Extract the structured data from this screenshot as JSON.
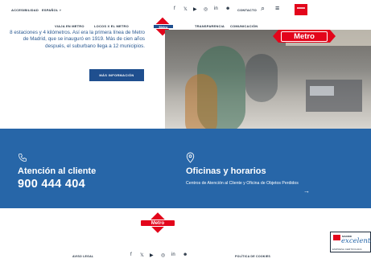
{
  "topbar": {
    "accessibility": "ACCESIBILIDAD",
    "language": "ESPAÑOL ˅",
    "social": [
      "f",
      "𝕏",
      "▶",
      "◎",
      "in",
      "☻"
    ],
    "contact": "CONTACTO",
    "search_icon": "⌕",
    "menu_icon": "≡"
  },
  "nav": {
    "items": [
      "VIAJA EN METRO",
      "LOCOS X EL METRO",
      "TRANSPARENCIA",
      "COMUNICACIÓN"
    ],
    "logo_text": "Metro"
  },
  "intro": {
    "text": "8 estaciones y 4 kilómetros. Así era la primera línea de Metro de Madrid, que se inauguró en 1919. Más de cien años después, el suburbano llega a 12 municipios.",
    "button": "MÁS INFORMACIÓN"
  },
  "photo": {
    "sign": "Metro"
  },
  "contact": {
    "attention_title": "Atención al cliente",
    "attention_phone": "900 444 404",
    "offices_title": "Oficinas y horarios",
    "offices_desc": "Centros de Atención al Cliente y Oficina de Objetos Perdidos",
    "arrow": "→",
    "phone_icon": "phone-icon",
    "location_icon": "location-pin-icon"
  },
  "footer": {
    "logo_text": "Metro",
    "legal": "AVISO LEGAL",
    "social": [
      "f",
      "𝕏",
      "▶",
      "◎",
      "in",
      "☻"
    ],
    "cookies": "POLÍTICA DE COOKIES",
    "badge_region": "MADRID",
    "badge_script": "excelente",
    "badge_cert": "EMPRESA CERTIFICADA"
  },
  "colors": {
    "metro_red": "#e3051b",
    "metro_blue": "#2766a8",
    "navy": "#1f4f8f"
  }
}
